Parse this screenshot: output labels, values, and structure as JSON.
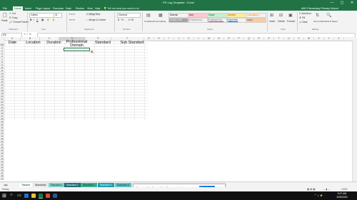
{
  "window": {
    "title": "PD Log Template - Excel",
    "controls": [
      "—",
      "▢",
      "✕"
    ]
  },
  "ribbon_tabs": [
    "File",
    "Home",
    "Insert",
    "Page Layout",
    "Formulas",
    "Data",
    "Review",
    "View",
    "Help"
  ],
  "active_tab": "Home",
  "tellme": "Tell me what you want to do",
  "account": "ABC Elementary Primary School",
  "ribbon": {
    "clipboard": {
      "cut": "Cut",
      "copy": "Copy",
      "format_painter": "Format Painter",
      "paste": "Paste",
      "label": "Clipboard"
    },
    "font": {
      "name": "Calibri",
      "size": "11",
      "label": "Font"
    },
    "alignment": {
      "wrap": "Wrap Text",
      "merge": "Merge & Center",
      "label": "Alignment"
    },
    "number": {
      "format": "General",
      "label": "Number"
    },
    "styles": {
      "conditional": "Conditional Formatting",
      "format_as_table": "Format as Table",
      "label": "Styles",
      "cells": [
        {
          "name": "Normal",
          "bg": "#ffffff",
          "fg": "#000000"
        },
        {
          "name": "Bad",
          "bg": "#ffc7ce",
          "fg": "#9c0006"
        },
        {
          "name": "Good",
          "bg": "#c6efce",
          "fg": "#006100"
        },
        {
          "name": "Neutral",
          "bg": "#ffeb9c",
          "fg": "#9c5700"
        },
        {
          "name": "Calculation",
          "bg": "#f2f2f2",
          "fg": "#fa7d00"
        },
        {
          "name": "Check Cell",
          "bg": "#a5a5a5",
          "fg": "#ffffff"
        },
        {
          "name": "Explanatory...",
          "bg": "#ffffff",
          "fg": "#7f7f7f"
        },
        {
          "name": "Followed Hy...",
          "bg": "#ffffff",
          "fg": "#954f72"
        },
        {
          "name": "Hyperlink",
          "bg": "#ffffff",
          "fg": "#0563c1"
        },
        {
          "name": "Input",
          "bg": "#ffcc99",
          "fg": "#3f3f76"
        }
      ]
    },
    "cells": {
      "insert": "Insert",
      "delete": "Delete",
      "format": "Format",
      "label": "Cells"
    },
    "editing": {
      "autosum": "AutoSum",
      "fill": "Fill",
      "clear": "Clear",
      "sort": "Sort & Filter",
      "find": "Find & Select",
      "label": "Editing"
    }
  },
  "formula_bar": {
    "name_box": "D2",
    "icons": "✕ ✓ fx",
    "value": ""
  },
  "columns": [
    "A",
    "B",
    "C",
    "D",
    "E",
    "F",
    "G",
    "H",
    "I",
    "J",
    "K",
    "L",
    "M",
    "N",
    "O",
    "P",
    "Q",
    "R",
    "S",
    "T",
    "U",
    "V",
    "W",
    "X",
    "Y",
    "Z",
    "AA",
    "AB",
    "AC",
    "AD",
    "AE",
    "AF"
  ],
  "rows": [
    "1",
    "2",
    "3",
    "4",
    "5",
    "6",
    "7",
    "8",
    "9",
    "10",
    "11",
    "12",
    "13",
    "14",
    "15",
    "16",
    "17",
    "18",
    "19",
    "20",
    "21",
    "22",
    "23",
    "24",
    "25",
    "26",
    "27",
    "28",
    "29",
    "30",
    "31",
    "32",
    "33",
    "34",
    "35",
    "36",
    "37",
    "38",
    "39",
    "40",
    "41",
    "42",
    "43",
    "44",
    "45",
    "46",
    "47",
    "48",
    "49"
  ],
  "headers": {
    "date": "Date",
    "location": "Location",
    "duration": "Duration",
    "domain_line1": "Professional",
    "domain_line2": "Domain",
    "standard": "Standard",
    "sub_standard": "Sub Standard"
  },
  "sheet_tabs": [
    {
      "name": "Tracker",
      "bg": "#ffffff",
      "fg": "#217346"
    },
    {
      "name": "Standards",
      "bg": "#e8e8e8",
      "fg": "#333333"
    },
    {
      "name": "Standard 1",
      "bg": "#7fd3c6",
      "fg": "#222222"
    },
    {
      "name": "Standard 2",
      "bg": "#1f6f78",
      "fg": "#ffffff"
    },
    {
      "name": "Standard 3",
      "bg": "#3bb391",
      "fg": "#111111"
    },
    {
      "name": "Standard 4",
      "bg": "#1b9fb0",
      "fg": "#ffffff"
    },
    {
      "name": "Standard 5",
      "bg": "#5cc2c9",
      "fg": "#111111"
    }
  ],
  "notification": {
    "message": "Screencastify - Screen Video Recorder is sharing your screen.",
    "stop": "Stop sharing",
    "hide": "Hide"
  },
  "status": {
    "left": "Ready",
    "zoom": "100%"
  },
  "taskbar": {
    "time": "9:07 AM",
    "date": "2/26/2020"
  }
}
